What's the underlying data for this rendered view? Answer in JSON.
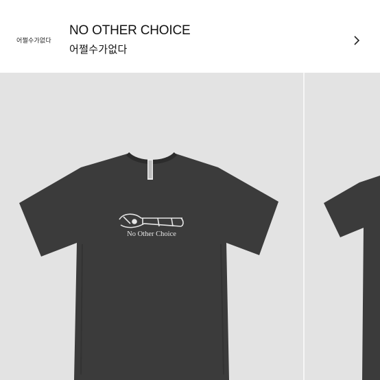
{
  "header": {
    "brand_logo_text": "어쩔수가없다",
    "title_en": "NO OTHER CHOICE",
    "title_ko": "어쩔수가없다",
    "chevron_icon": "chevron-right-icon"
  },
  "product": {
    "shirt_print_text": "No Other Choice",
    "shirt_color": "#3a3a3a",
    "background_color": "#e3e3e3"
  }
}
